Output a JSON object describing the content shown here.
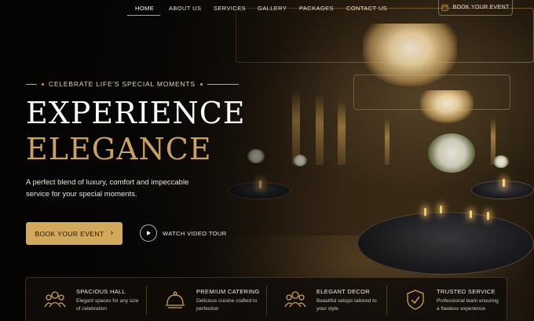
{
  "nav": {
    "items": [
      {
        "label": "HOME",
        "active": true
      },
      {
        "label": "ABOUT US"
      },
      {
        "label": "SERVICES"
      },
      {
        "label": "GALLERY"
      },
      {
        "label": "PACKAGES"
      },
      {
        "label": "CONTACT US"
      }
    ],
    "book_label": "BOOK YOUR EVENT",
    "book_icon": "calendar-icon"
  },
  "hero": {
    "tagline": "CELEBRATE LIFE'S SPECIAL MOMENTS",
    "title_line1": "EXPERIENCE",
    "title_line2": "ELEGANCE",
    "description": "A perfect blend of luxury, comfort and impeccable service for your special moments.",
    "cta_label": "BOOK YOUR EVENT",
    "cta_icon": "chevron-right-icon",
    "video_label": "WATCH VIDEO TOUR",
    "video_icon": "play-icon"
  },
  "features": [
    {
      "title": "SPACIOUS HALL",
      "desc": "Elegant spaces for any size of celebration",
      "icon": "people-group-icon"
    },
    {
      "title": "PREMIUM CATERING",
      "desc": "Delicious cuisine crafted to perfection",
      "icon": "cloche-icon"
    },
    {
      "title": "ELEGANT DECOR",
      "desc": "Beautiful setups tailored to your style",
      "icon": "people-group-icon"
    },
    {
      "title": "TRUSTED SERVICE",
      "desc": "Professional team ensuring a flawless experience",
      "icon": "shield-check-icon"
    }
  ],
  "colors": {
    "accent": "#c9a25b",
    "button": "#d1a85c",
    "background": "#0b0906"
  }
}
